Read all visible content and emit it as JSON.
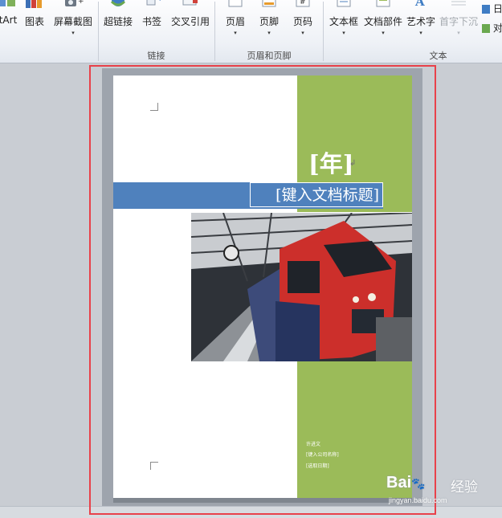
{
  "ribbon": {
    "buttons": {
      "smartart": "tArt",
      "chart": "图表",
      "screenshot": "屏幕截图",
      "hyperlink": "超链接",
      "bookmark": "书签",
      "crossref": "交叉引用",
      "header": "页眉",
      "footer": "页脚",
      "pagenum": "页码",
      "textbox": "文本框",
      "quickparts": "文档部件",
      "wordart": "艺术字",
      "dropcap": "首字下沉",
      "right1": "日",
      "right2": "对"
    },
    "groups": {
      "links": "链接",
      "header_footer": "页眉和页脚",
      "text": "文本"
    },
    "dropdown_glyph": "▾"
  },
  "page": {
    "year": "[年]",
    "paragraph_mark": "↲",
    "title": "[键入文档标题]",
    "author": "许进文",
    "company": "[键入公司名称]",
    "date": "[选取日期]"
  },
  "watermark": {
    "brand": "Bai",
    "paw": "🐾",
    "jingyan": "经验",
    "url": "jingyan.baidu.com"
  },
  "colors": {
    "green": "#9bbb59",
    "blue": "#4f81bd",
    "highlight": "#e8414a"
  }
}
